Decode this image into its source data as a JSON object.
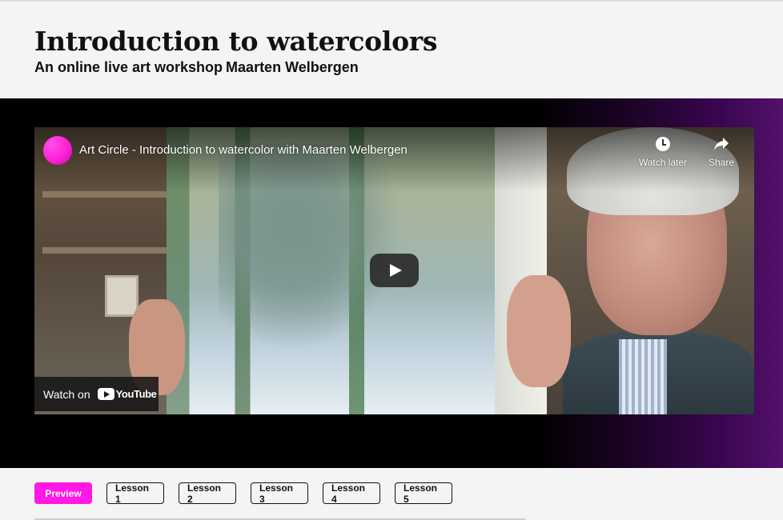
{
  "header": {
    "title": "Introduction to watercolors",
    "subtitle": "An online live art workshop",
    "instructor": "Maarten Welbergen"
  },
  "video": {
    "title": "Art Circle - Introduction to watercolor with Maarten Welbergen",
    "watch_later_label": "Watch later",
    "share_label": "Share",
    "watch_on_label": "Watch on",
    "youtube_label": "YouTube",
    "channel_avatar_color": "#ff20d5"
  },
  "tabs": [
    {
      "label": "Preview",
      "active": true
    },
    {
      "label": "Lesson 1",
      "active": false
    },
    {
      "label": "Lesson 2",
      "active": false
    },
    {
      "label": "Lesson 3",
      "active": false
    },
    {
      "label": "Lesson 4",
      "active": false
    },
    {
      "label": "Lesson 5",
      "active": false
    }
  ],
  "colors": {
    "accent": "#ff18e6",
    "stage_background": "#000000",
    "page_background": "#f4f4f4"
  }
}
